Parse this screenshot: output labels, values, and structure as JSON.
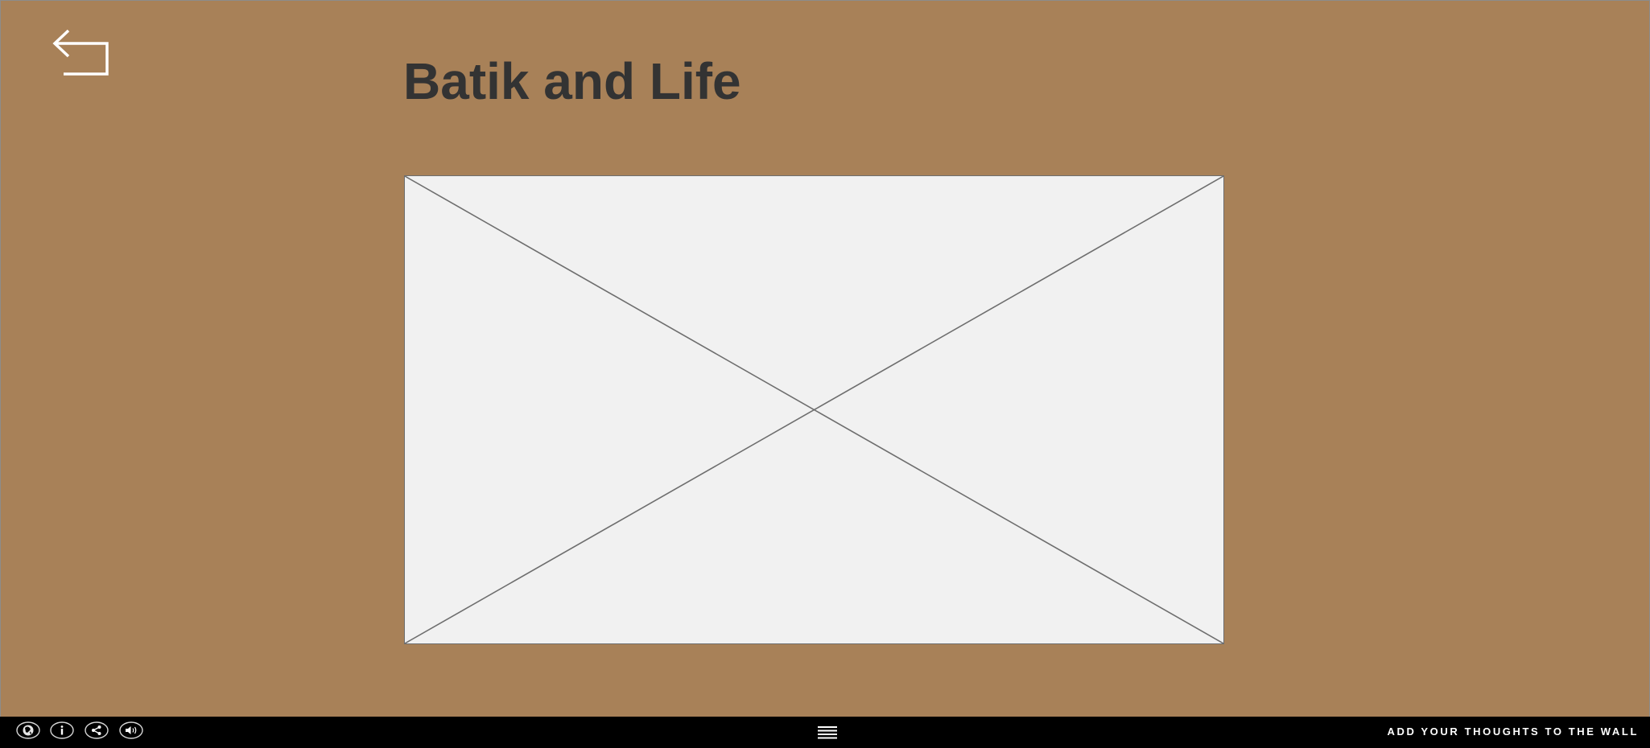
{
  "page": {
    "title": "Batik and Life",
    "background_color": "#a88158"
  },
  "header": {
    "back_icon": "back-arrow-icon"
  },
  "main": {
    "media": {
      "type": "image-placeholder",
      "icon": "image-placeholder-icon"
    }
  },
  "bottom_bar": {
    "background_color": "#000000",
    "icons": [
      {
        "name": "globe-icon"
      },
      {
        "name": "info-icon"
      },
      {
        "name": "share-icon"
      },
      {
        "name": "audio-icon"
      }
    ],
    "menu_icon": "hamburger-menu-icon",
    "wall_link": "ADD YOUR THOUGHTS TO THE WALL"
  }
}
